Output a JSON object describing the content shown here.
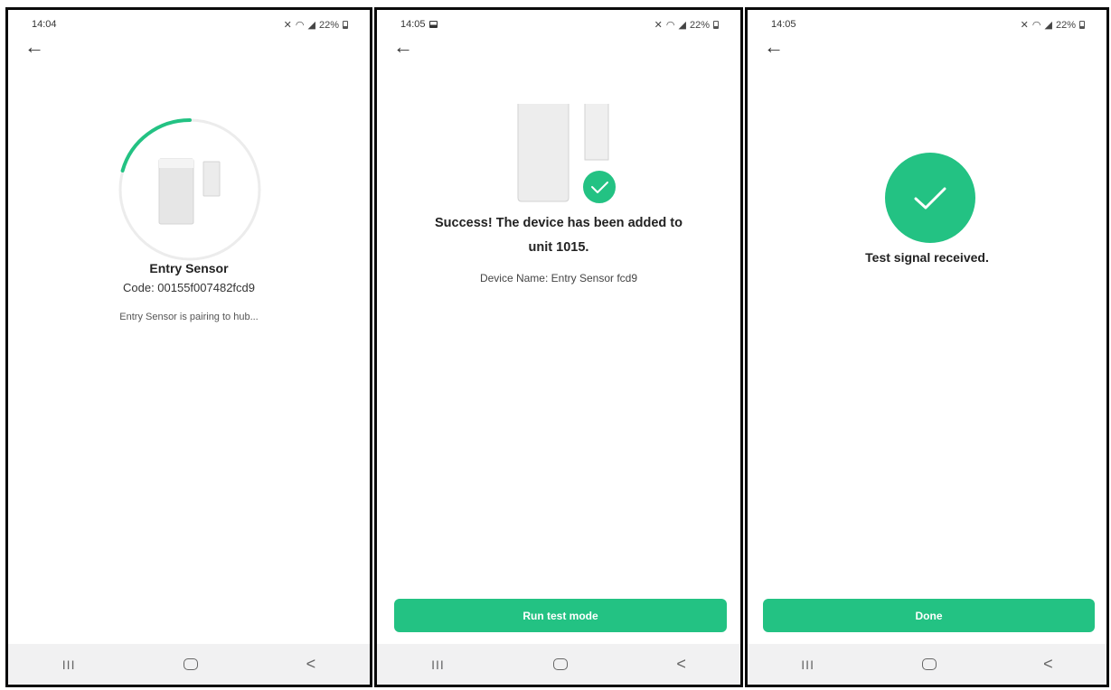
{
  "colors": {
    "accent": "#23c283",
    "nav_bg": "#f1f1f2",
    "ring_track": "#ececec"
  },
  "screens": [
    {
      "status": {
        "time": "14:04",
        "battery": "22%"
      },
      "title": "Entry Sensor",
      "code": "Code: 00155f007482fcd9",
      "message": "Entry Sensor is pairing to hub..."
    },
    {
      "status": {
        "time": "14:05",
        "battery": "22%"
      },
      "success_line1": "Success! The device has been added to",
      "success_line2": "unit 1015.",
      "device_name": "Device Name: Entry Sensor fcd9",
      "button_label": "Run test mode"
    },
    {
      "status": {
        "time": "14:05",
        "battery": "22%"
      },
      "message": "Test signal received.",
      "button_label": "Done"
    }
  ],
  "nav": {
    "recent": "III",
    "back": "<"
  }
}
